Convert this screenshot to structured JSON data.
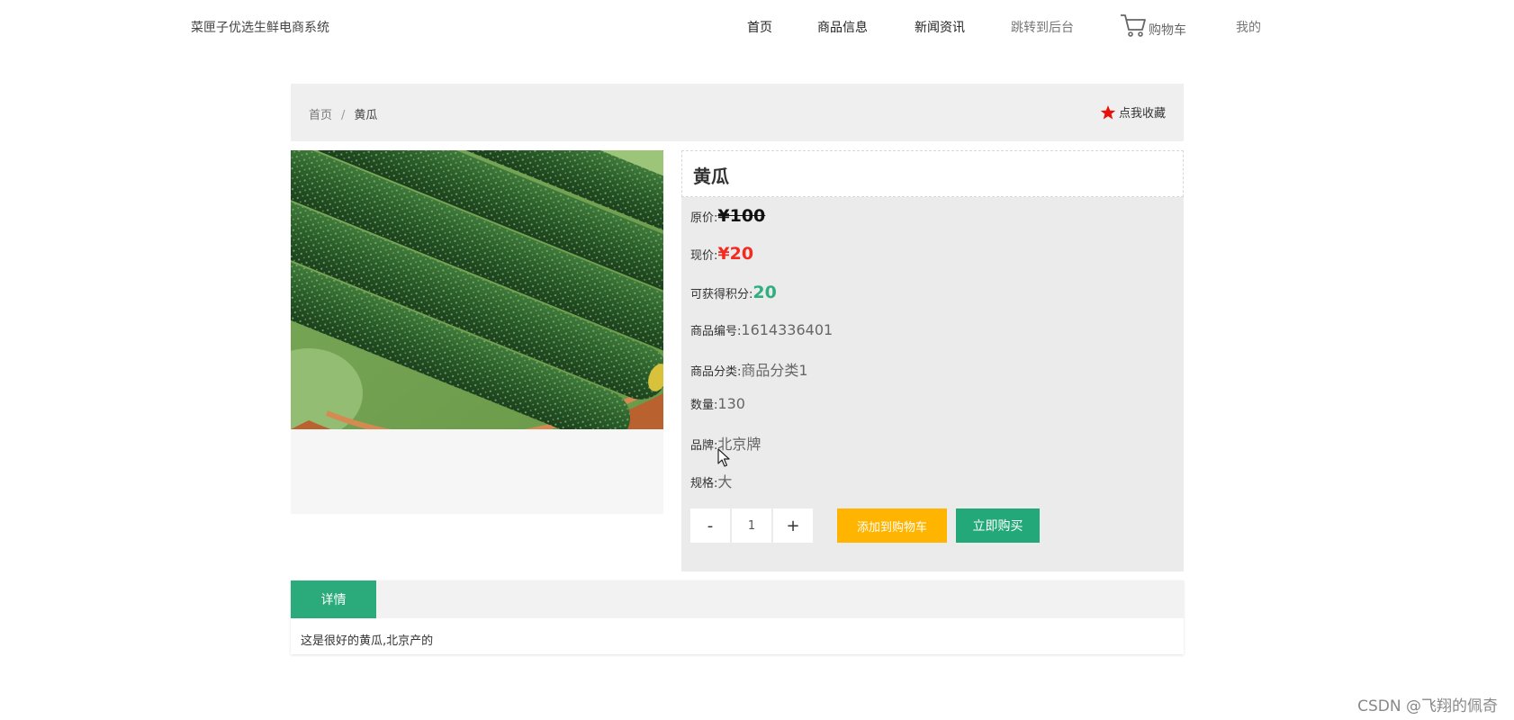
{
  "nav": {
    "brand": "菜匣子优选生鲜电商系统",
    "items": [
      "首页",
      "商品信息",
      "新闻资讯",
      "跳转到后台"
    ],
    "cart_label": "购物车",
    "mine_label": "我的"
  },
  "breadcrumb": {
    "home": "首页",
    "separator": "/",
    "current": "黄瓜"
  },
  "favorite": {
    "label": "点我收藏",
    "icon": "star-icon",
    "icon_color": "#e8100a"
  },
  "product": {
    "name": "黄瓜",
    "original_price_label": "原价:",
    "original_price": "¥100",
    "current_price_label": "现价:",
    "current_price": "¥20",
    "points_label": "可获得积分:",
    "points": "20",
    "code_label": "商品编号:",
    "code": "1614336401",
    "category_label": "商品分类:",
    "category": "商品分类1",
    "quantity_label": "数量:",
    "quantity": "130",
    "brand_label": "品牌:",
    "brand": "北京牌",
    "spec_label": "规格:",
    "spec": "大"
  },
  "actions": {
    "minus": "-",
    "qty_value": "1",
    "plus": "+",
    "add_to_cart": "添加到购物车",
    "buy_now": "立即购买"
  },
  "tabs": {
    "active": "详情",
    "description": "这是很好的黄瓜,北京产的"
  },
  "watermark": "CSDN @飞翔的佩奇",
  "colors": {
    "accent_green": "#2bab7b",
    "cart_orange": "#ffb400",
    "price_red": "#f32a1f",
    "points_green": "#2fae7f"
  }
}
